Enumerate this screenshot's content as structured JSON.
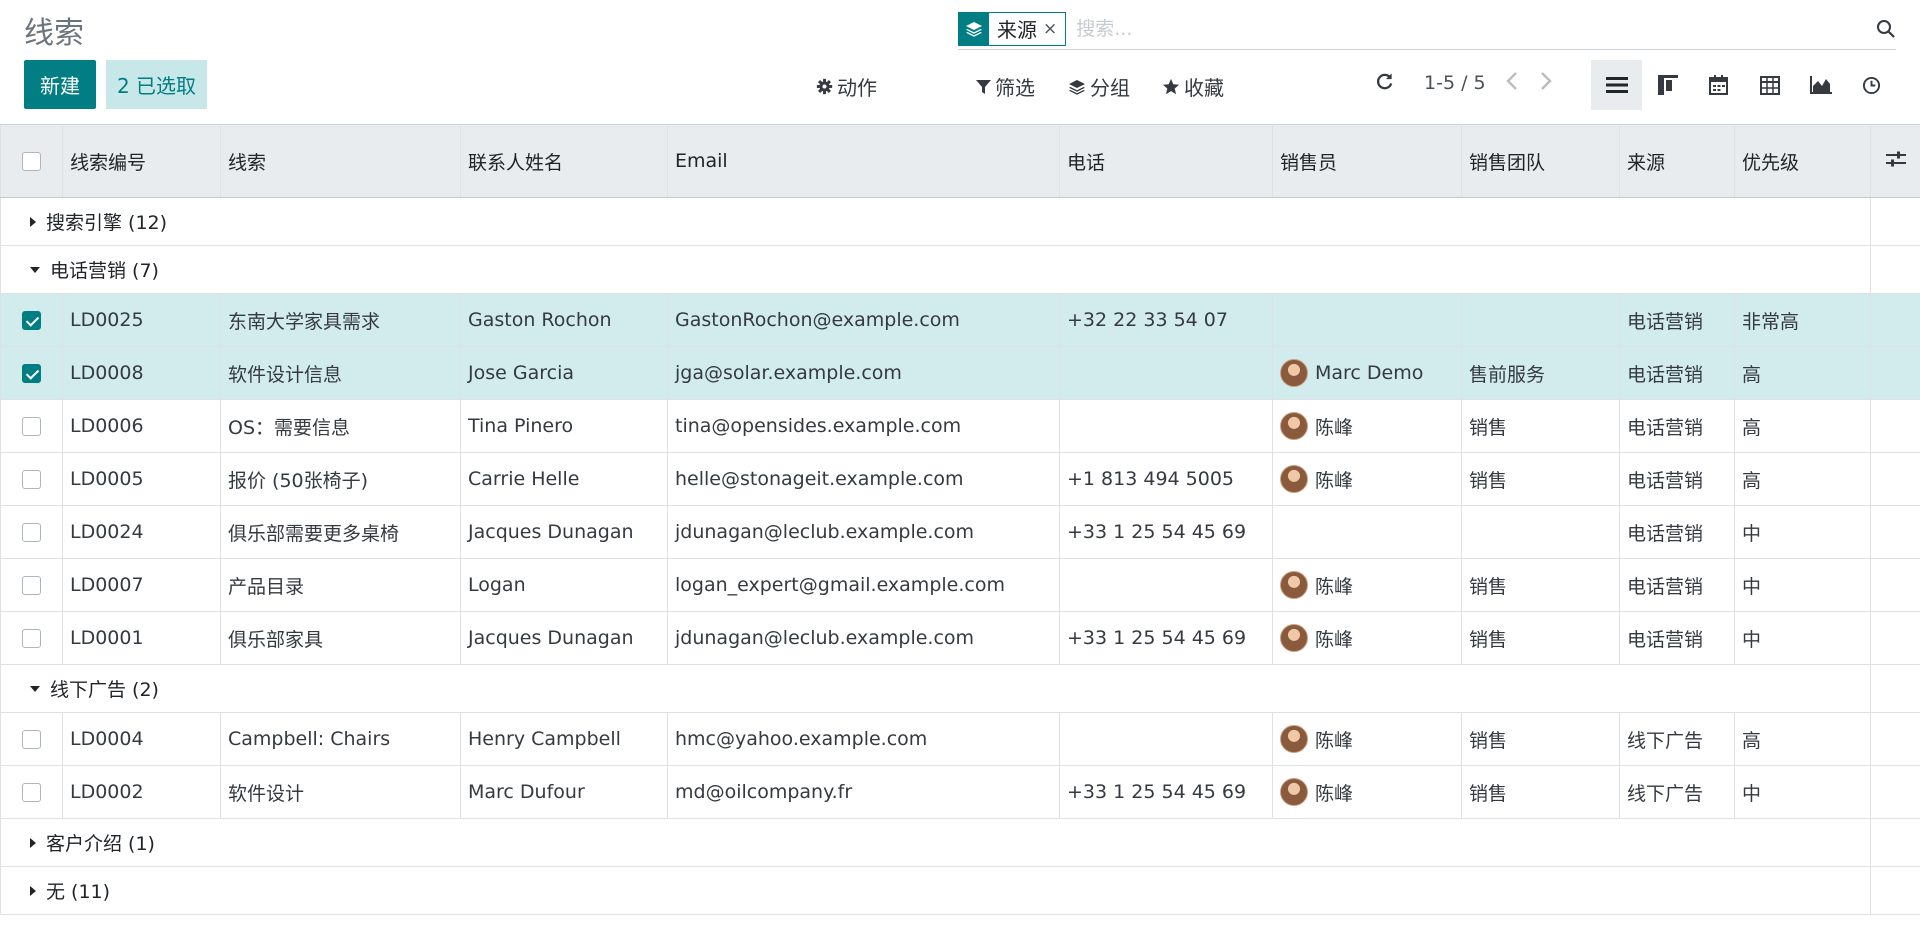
{
  "page": {
    "title": "线索"
  },
  "search": {
    "facet_label": "来源",
    "facet_close": "×",
    "placeholder": "搜索..."
  },
  "buttons": {
    "new_label": "新建",
    "selected_label": "2 已选取"
  },
  "toolbar": {
    "action": "动作",
    "filter": "筛选",
    "group": "分组",
    "favorite": "收藏"
  },
  "pager": {
    "text": "1-5 / 5"
  },
  "columns": [
    "线索编号",
    "线索",
    "联系人姓名",
    "Email",
    "电话",
    "销售员",
    "销售团队",
    "来源",
    "优先级"
  ],
  "groups": [
    {
      "label": "搜索引擎 (12)",
      "expanded": false,
      "rows": []
    },
    {
      "label": "电话营销 (7)",
      "expanded": true,
      "rows": [
        {
          "selected": true,
          "id": "LD0025",
          "name": "东南大学家具需求",
          "contact": "Gaston Rochon",
          "email": "GastonRochon@example.com",
          "phone": "+32 22 33 54 07",
          "user": "",
          "team": "",
          "source": "电话营销",
          "priority": "非常高"
        },
        {
          "selected": true,
          "id": "LD0008",
          "name": "软件设计信息",
          "contact": "Jose Garcia",
          "email": "jga@solar.example.com",
          "phone": "",
          "user": "Marc Demo",
          "team": "售前服务",
          "source": "电话营销",
          "priority": "高"
        },
        {
          "selected": false,
          "id": "LD0006",
          "name": "OS：需要信息",
          "contact": "Tina Pinero",
          "email": "tina@opensides.example.com",
          "phone": "",
          "user": "陈峰",
          "team": "销售",
          "source": "电话营销",
          "priority": "高"
        },
        {
          "selected": false,
          "id": "LD0005",
          "name": "报价 (50张椅子)",
          "contact": "Carrie Helle",
          "email": "helle@stonageit.example.com",
          "phone": "+1 813 494 5005",
          "user": "陈峰",
          "team": "销售",
          "source": "电话营销",
          "priority": "高"
        },
        {
          "selected": false,
          "id": "LD0024",
          "name": "俱乐部需要更多桌椅",
          "contact": "Jacques Dunagan",
          "email": "jdunagan@leclub.example.com",
          "phone": "+33 1 25 54 45 69",
          "user": "",
          "team": "",
          "source": "电话营销",
          "priority": "中"
        },
        {
          "selected": false,
          "id": "LD0007",
          "name": "产品目录",
          "contact": "Logan",
          "email": "logan_expert@gmail.example.com",
          "phone": "",
          "user": "陈峰",
          "team": "销售",
          "source": "电话营销",
          "priority": "中"
        },
        {
          "selected": false,
          "id": "LD0001",
          "name": "俱乐部家具",
          "contact": "Jacques Dunagan",
          "email": "jdunagan@leclub.example.com",
          "phone": "+33 1 25 54 45 69",
          "user": "陈峰",
          "team": "销售",
          "source": "电话营销",
          "priority": "中"
        }
      ]
    },
    {
      "label": "线下广告 (2)",
      "expanded": true,
      "rows": [
        {
          "selected": false,
          "id": "LD0004",
          "name": "Campbell: Chairs",
          "contact": "Henry Campbell",
          "email": "hmc@yahoo.example.com",
          "phone": "",
          "user": "陈峰",
          "team": "销售",
          "source": "线下广告",
          "priority": "高"
        },
        {
          "selected": false,
          "id": "LD0002",
          "name": "软件设计",
          "contact": "Marc Dufour",
          "email": "md@oilcompany.fr",
          "phone": "+33 1 25 54 45 69",
          "user": "陈峰",
          "team": "销售",
          "source": "线下广告",
          "priority": "中"
        }
      ]
    },
    {
      "label": "客户介绍 (1)",
      "expanded": false,
      "rows": []
    },
    {
      "label": "无 (11)",
      "expanded": false,
      "rows": []
    }
  ],
  "colors": {
    "primary": "#017e84",
    "selected_row": "#d2ecee",
    "header_bg": "#e9ecef"
  },
  "icons": {
    "facet": "layers-icon",
    "search": "search-icon",
    "action": "gear-icon",
    "filter": "funnel-icon",
    "group": "layers-icon",
    "favorite": "star-icon",
    "refresh": "refresh-icon",
    "views": [
      "list-view-icon",
      "kanban-view-icon",
      "calendar-view-icon",
      "pivot-view-icon",
      "graph-view-icon",
      "activity-view-icon"
    ]
  }
}
